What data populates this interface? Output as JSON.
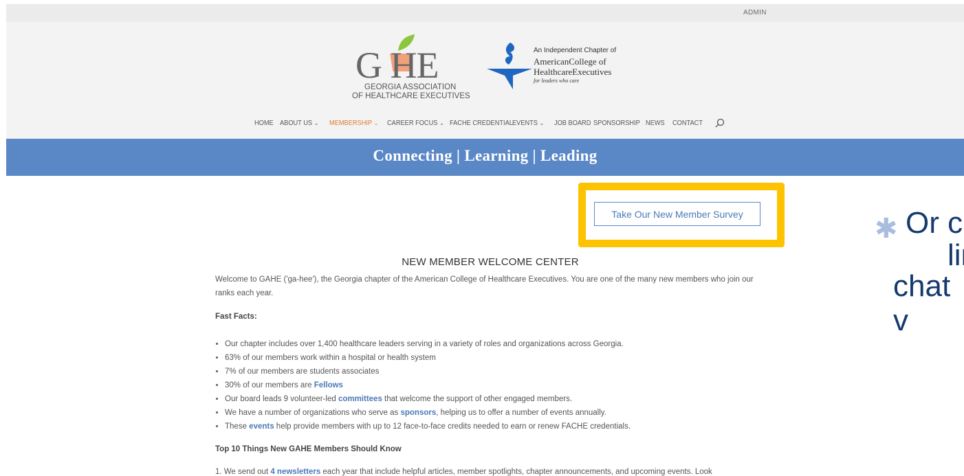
{
  "topbar": {
    "admin_label": "ADMIN"
  },
  "logo_gahe": {
    "letters": "G HE",
    "line1": "GEORGIA ASSOCIATION",
    "line2": "OF HEALTHCARE EXECUTIVES"
  },
  "logo_ache": {
    "line1": "An Independent Chapter of",
    "line2": "AmericanCollege of",
    "line3": "HealthcareExecutives",
    "line4": "for leaders who care"
  },
  "nav": {
    "items": [
      {
        "label": "HOME",
        "has_dropdown": false
      },
      {
        "label": "ABOUT US",
        "has_dropdown": true
      },
      {
        "label": "MEMBERSHIP",
        "has_dropdown": true,
        "active": true
      },
      {
        "label": "CAREER FOCUS",
        "has_dropdown": true
      },
      {
        "label": "FACHE CREDENTIAL",
        "has_dropdown": false
      },
      {
        "label": "EVENTS",
        "has_dropdown": true
      },
      {
        "label": "JOB BOARD",
        "has_dropdown": false
      },
      {
        "label": "SPONSORSHIP",
        "has_dropdown": false
      },
      {
        "label": "NEWS",
        "has_dropdown": false
      },
      {
        "label": "CONTACT",
        "has_dropdown": false
      }
    ],
    "search_icon": "search-icon",
    "active_color": "#e07a2e"
  },
  "banner": {
    "tagline": "Connecting | Learning | Leading",
    "color": "#5a87c6"
  },
  "survey": {
    "button_label": "Take Our New Member Survey",
    "highlight_color": "#fdc200"
  },
  "overlay": {
    "line1": "Or c",
    "line2": "lin",
    "line3": "chat v"
  },
  "content": {
    "heading": "NEW MEMBER WELCOME CENTER",
    "intro": "Welcome to GAHE ('ga-hee'), the Georgia chapter of the American College of Healthcare Executives. You are one of the many new members who join our ranks each year.",
    "fast_facts_title": "Fast Facts:",
    "facts": [
      {
        "text": "Our chapter includes over 1,400 healthcare leaders serving in a variety of roles and organizations across Georgia."
      },
      {
        "text": "63% of our members work within a hospital or health system"
      },
      {
        "text": "7% of our members are students associates"
      },
      {
        "before": "30% of our members are ",
        "link": "Fellows",
        "after": ""
      },
      {
        "before": "Our board leads 9 volunteer-led ",
        "link": "committees",
        "after": " that welcome the support of other engaged members."
      },
      {
        "before": "We have a number of organizations who serve as ",
        "link": "sponsors",
        "after": ", helping us to offer a number of events annually."
      },
      {
        "before": "These ",
        "link": "events",
        "after": " help provide members with up to 12 face-to-face credits needed to earn or renew FACHE credentials."
      }
    ],
    "top10_title": "Top 10 Things New GAHE Members Should Know",
    "point1": {
      "before": "1. We send out ",
      "link": "4 newsletters",
      "after": " each year that include helpful articles, member spotlights, chapter announcements, and upcoming events. Look"
    }
  }
}
